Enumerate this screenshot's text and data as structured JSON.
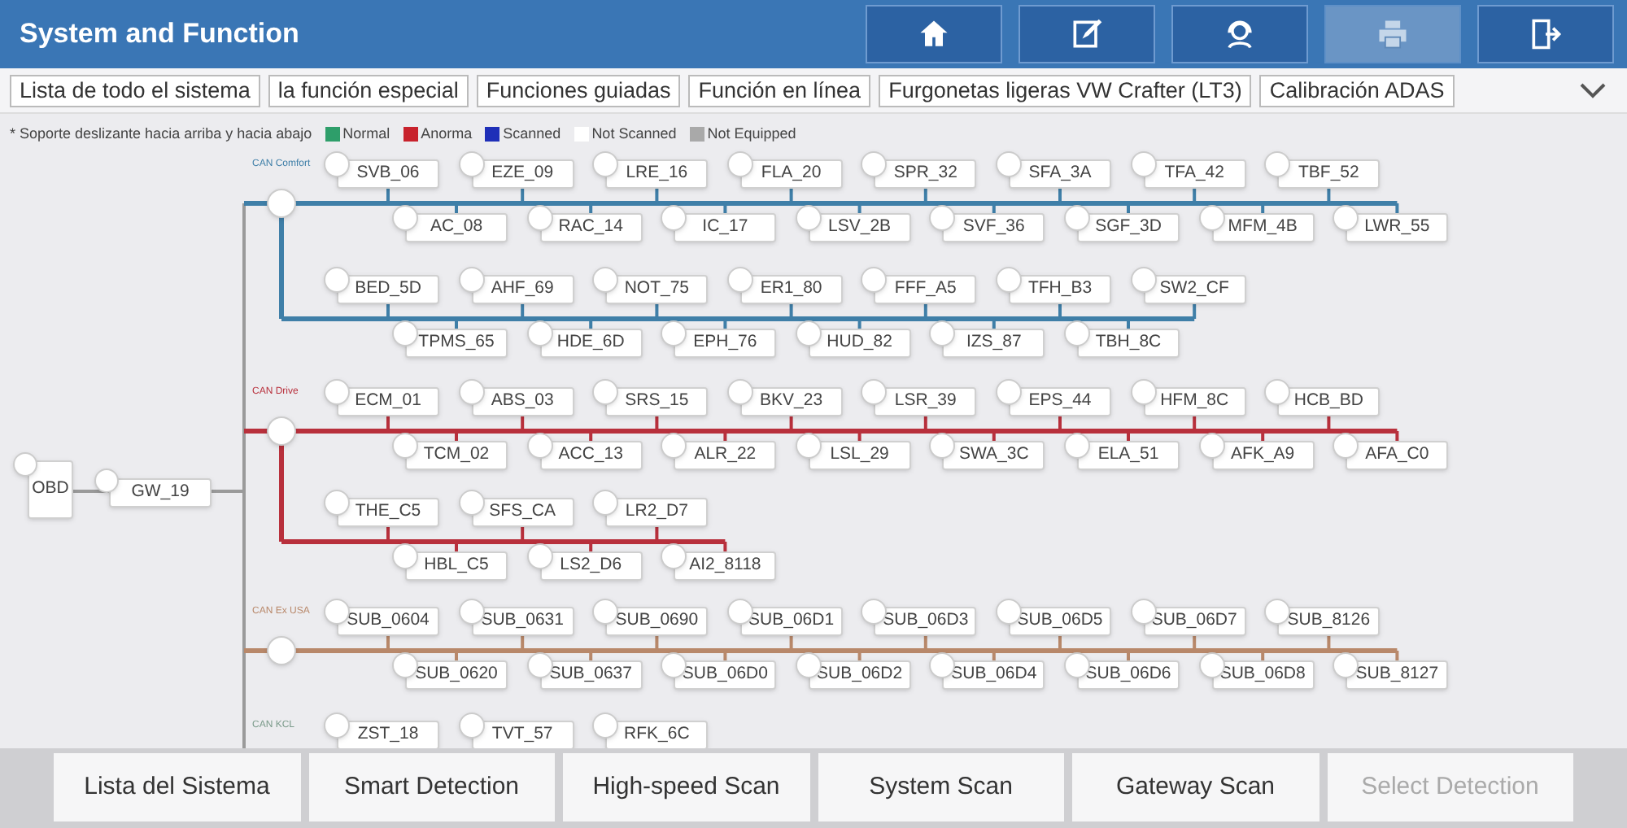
{
  "window": {
    "title": "System and Function"
  },
  "toolbar": [
    {
      "kind": "home",
      "disabled": false
    },
    {
      "kind": "edit",
      "disabled": false
    },
    {
      "kind": "support",
      "disabled": false
    },
    {
      "kind": "print",
      "disabled": true
    },
    {
      "kind": "exit",
      "disabled": false
    }
  ],
  "tabs": [
    "Lista de todo el sistema",
    "la función especial",
    "Funciones guiadas",
    "Función en línea",
    "Furgonetas ligeras VW Crafter (LT3)",
    "Calibración ADAS"
  ],
  "legend": {
    "note": "* Soporte deslizante hacia arriba y hacia abajo",
    "items": [
      {
        "label": "Normal",
        "color": "#2e9e6a"
      },
      {
        "label": "Anorma",
        "color": "#c8222c"
      },
      {
        "label": "Scanned",
        "color": "#1f2fb8"
      },
      {
        "label": "Not Scanned",
        "color": "#ffffff"
      },
      {
        "label": "Not Equipped",
        "color": "#a9a9a9"
      }
    ]
  },
  "root": {
    "obd": "OBD",
    "gateway": "GW_19"
  },
  "buses": [
    {
      "label": "CAN Comfort",
      "color": "#3f7fa8",
      "lines": [
        {
          "above": [
            "SVB_06",
            "EZE_09",
            "LRE_16",
            "FLA_20",
            "SPR_32",
            "SFA_3A",
            "TFA_42",
            "TBF_52"
          ],
          "below": [
            "AC_08",
            "RAC_14",
            "IC_17",
            "LSV_2B",
            "SVF_36",
            "SGF_3D",
            "MFM_4B",
            "LWR_55"
          ]
        },
        {
          "above": [
            "BED_5D",
            "AHF_69",
            "NOT_75",
            "ER1_80",
            "FFF_A5",
            "TFH_B3",
            "SW2_CF"
          ],
          "below": [
            "TPMS_65",
            "HDE_6D",
            "EPH_76",
            "HUD_82",
            "IZS_87",
            "TBH_8C"
          ]
        }
      ]
    },
    {
      "label": "CAN Drive",
      "color": "#b8303c",
      "lines": [
        {
          "above": [
            "ECM_01",
            "ABS_03",
            "SRS_15",
            "BKV_23",
            "LSR_39",
            "EPS_44",
            "HFM_8C",
            "HCB_BD"
          ],
          "below": [
            "TCM_02",
            "ACC_13",
            "ALR_22",
            "LSL_29",
            "SWA_3C",
            "ELA_51",
            "AFK_A9",
            "AFA_C0"
          ]
        },
        {
          "above": [
            "THE_C5",
            "SFS_CA",
            "LR2_D7"
          ],
          "below": [
            "HBL_C5",
            "LS2_D6",
            "AI2_8118"
          ]
        }
      ]
    },
    {
      "label": "CAN Ex USA",
      "color": "#b8886a",
      "lines": [
        {
          "above": [
            "SUB_0604",
            "SUB_0631",
            "SUB_0690",
            "SUB_06D1",
            "SUB_06D3",
            "SUB_06D5",
            "SUB_06D7",
            "SUB_8126"
          ],
          "below": [
            "SUB_0620",
            "SUB_0637",
            "SUB_06D0",
            "SUB_06D2",
            "SUB_06D4",
            "SUB_06D6",
            "SUB_06D8",
            "SUB_8127"
          ]
        }
      ]
    },
    {
      "label": "CAN KCL",
      "color": "#7a9a8a",
      "lines": [
        {
          "above": [
            "ZST_18",
            "TVT_57",
            "RFK_6C"
          ]
        }
      ]
    }
  ],
  "actions": [
    {
      "label": "Lista del Sistema",
      "disabled": false
    },
    {
      "label": "Smart Detection",
      "disabled": false
    },
    {
      "label": "High-speed Scan",
      "disabled": false
    },
    {
      "label": "System Scan",
      "disabled": false
    },
    {
      "label": "Gateway Scan",
      "disabled": false
    },
    {
      "label": "Select Detection",
      "disabled": true
    }
  ]
}
